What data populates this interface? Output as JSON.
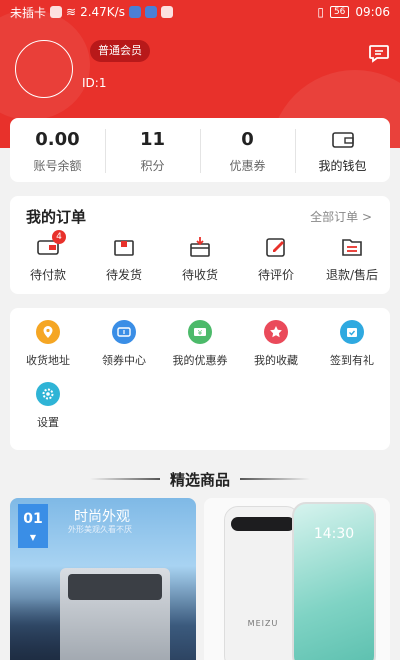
{
  "status_bar": {
    "carrier": "未插卡",
    "speed": "2.47K/s",
    "battery": "56",
    "time": "09:06"
  },
  "profile": {
    "member_level": "普通会员",
    "user_id": "ID:1"
  },
  "wallet": {
    "balance": {
      "value": "0.00",
      "label": "账号余额"
    },
    "points": {
      "value": "11",
      "label": "积分"
    },
    "coupons": {
      "value": "0",
      "label": "优惠券"
    },
    "my_wallet_label": "我的钱包"
  },
  "orders": {
    "title": "我的订单",
    "all_label": "全部订单 >",
    "items": [
      {
        "label": "待付款",
        "icon": "wallet-icon",
        "badge": "4"
      },
      {
        "label": "待发货",
        "icon": "package-icon"
      },
      {
        "label": "待收货",
        "icon": "receive-box-icon"
      },
      {
        "label": "待评价",
        "icon": "edit-icon"
      },
      {
        "label": "退款/售后",
        "icon": "refund-icon"
      }
    ]
  },
  "services": [
    {
      "label": "收货地址",
      "icon": "location-icon",
      "color": "#f5a623"
    },
    {
      "label": "领券中心",
      "icon": "ticket-icon",
      "color": "#3a8ee6"
    },
    {
      "label": "我的优惠券",
      "icon": "coupon-icon",
      "color": "#4cba6a"
    },
    {
      "label": "我的收藏",
      "icon": "star-icon",
      "color": "#ea4a5a"
    },
    {
      "label": "签到有礼",
      "icon": "calendar-check-icon",
      "color": "#2fa9e0"
    },
    {
      "label": "设置",
      "icon": "gear-icon",
      "color": "#2fb4d6"
    }
  ],
  "featured": {
    "title": "精选商品",
    "products": [
      {
        "tag": "01",
        "ad_title": "时尚外观",
        "ad_subtitle": "外形美观久看不厌"
      },
      {
        "screen_time": "14:30",
        "brand": "MEIZU"
      }
    ]
  },
  "colors": {
    "header": "#e8312b",
    "badge_bg": "#b8191a",
    "accent": "#e8312b"
  }
}
